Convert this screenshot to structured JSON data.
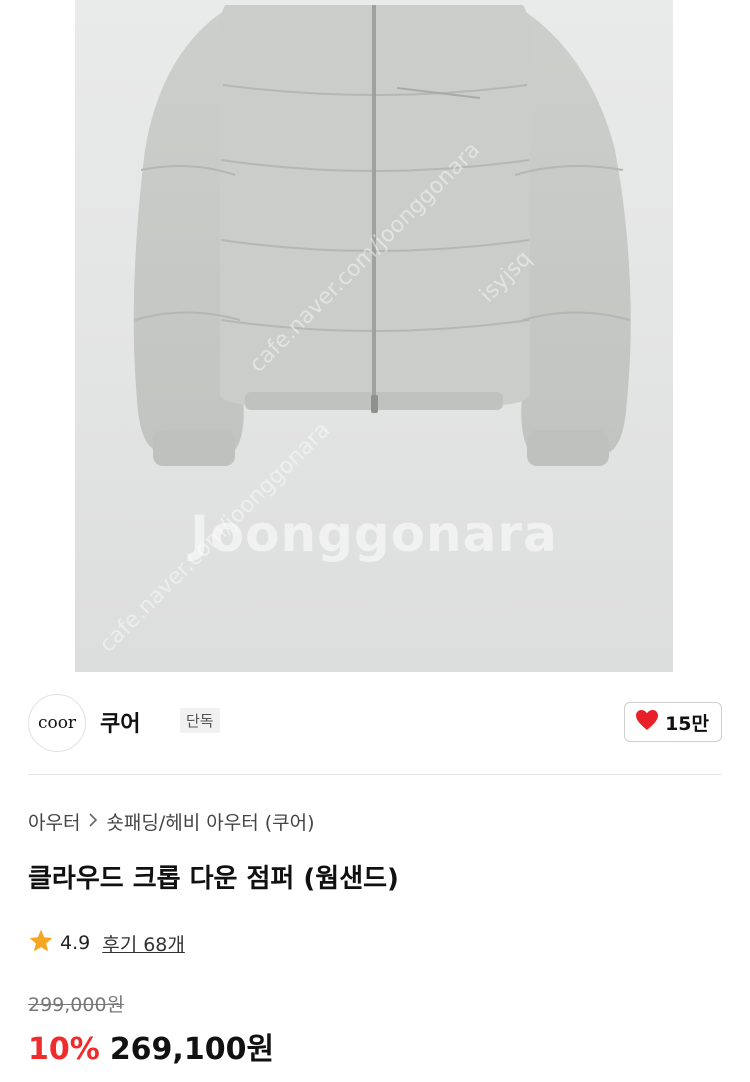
{
  "product_image": {
    "watermark": "Joonggonara",
    "watermark_small_1": "cafe.naver.com/joonggonara",
    "watermark_small_2": "isyjsq",
    "jacket_color": "#c9cbc8"
  },
  "seller": {
    "logo_text": "coor",
    "name": "쿠어",
    "badge": "단독",
    "like_icon": "heart-icon",
    "like_color": "#e8202a",
    "like_count": "15만"
  },
  "breadcrumb": {
    "items": [
      "아우터",
      "숏패딩/헤비 아우터 (쿠어)"
    ],
    "separator_icon": "chevron-right-icon"
  },
  "product": {
    "title": "클라우드 크롭 다운 점퍼 (웜샌드)",
    "rating_icon": "star-icon",
    "rating_color": "#f5a623",
    "rating": "4.9",
    "reviews": "후기 68개",
    "original_price": "299,000원",
    "discount": "10%",
    "price": "269,100원",
    "discount_color": "#ef2b2b"
  }
}
